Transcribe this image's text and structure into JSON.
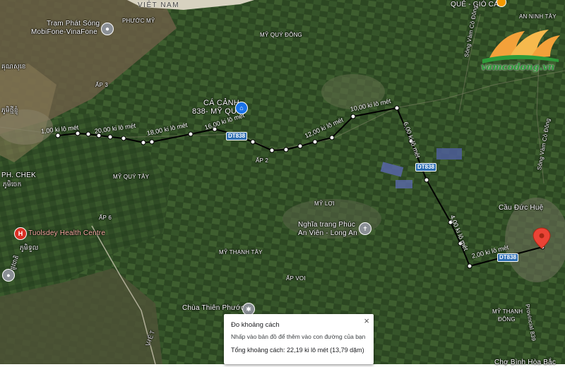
{
  "places": {
    "tram_phat_song": "Trạm Phát Sóng\nMobiFone-VinaFone",
    "tram_line1": "Trạm Phát Sóng",
    "tram_line2": "MobiFone-VinaFone",
    "phuoc_my": "PHƯỚC MỸ",
    "ap3": "ẤP 3",
    "ca_canh": "CÁ CẢNH",
    "ca_canh_sub": "838- MỸ QUÝ",
    "my_quy_dong": "MỸ QUÝ ĐÔNG",
    "my_quy_tay": "MỸ QUÝ TÂY",
    "ap2": "ẤP 2",
    "ap6": "ẤP 6",
    "my_loi": "MỸ LỢI",
    "nghia_trang_1": "Nghĩa trang Phúc",
    "nghia_trang_2": "An Viên - Long An",
    "my_thanh_tay": "MỸ THẠNH TÂY",
    "ap_voi": "ẤP VOI",
    "chua_thien_phuoc": "Chùa Thiên Phước",
    "cau_duc_hue": "Cầu Đức Huệ",
    "my_thanh_dong_1": "MỸ THẠNH",
    "my_thanh_dong_2": "ĐÔNG",
    "que_gio_ca": "QUÊ - GIÓ CÁ",
    "an_ninh_tay": "AN NINH TÂY",
    "ph_chek": "PH. CHEK",
    "khmer1": "ភូមិចេក",
    "khmer2": "ភូមិថ្មីខ្ញុំ",
    "khmer3": "គុណសុខេ",
    "tuolsdey": "Tuolsdey Health Centre",
    "khmer4": "ភូមិទួល",
    "viet_nam": "VIỆT NAM",
    "viet_bottom": "VIỆT",
    "cho_binh_hoa": "Chợ Bình Hòa Bắc",
    "song_vam_co": "Sông Vàm Cỏ Đông",
    "song_vam_co2": "Sông Vàm Cỏ Đông",
    "hwy_3": "ផ្លូវជាតិ",
    "provincial_839": "Provincial 839"
  },
  "roads": {
    "dt838": "DT838"
  },
  "segment_labels": {
    "s1": "1,00 ki lô mét",
    "s2": "20,00 ki lô mét",
    "s3": "18,00 ki lô mét",
    "s4": "16,00 ki lô mét",
    "s5": "12,00 ki lô mét",
    "s6": "10,00 ki lô mét",
    "s7": "6,00 ki lô mét",
    "s8": "4,00 ki lô mét",
    "s9": "2,00 ki lô mét"
  },
  "panel": {
    "title": "Đo khoảng cách",
    "hint": "Nhấp vào bản đồ để thêm vào con đường của bạn",
    "total": "Tổng khoảng cách: 22,19 ki lô mét (13,79 dặm)",
    "close": "×"
  },
  "logo": {
    "text": "vamcodong.vn"
  },
  "colors": {
    "route": "#000000",
    "marker": "#e53935",
    "poi_blue": "#1a73e8",
    "poi_red": "#d93025"
  }
}
